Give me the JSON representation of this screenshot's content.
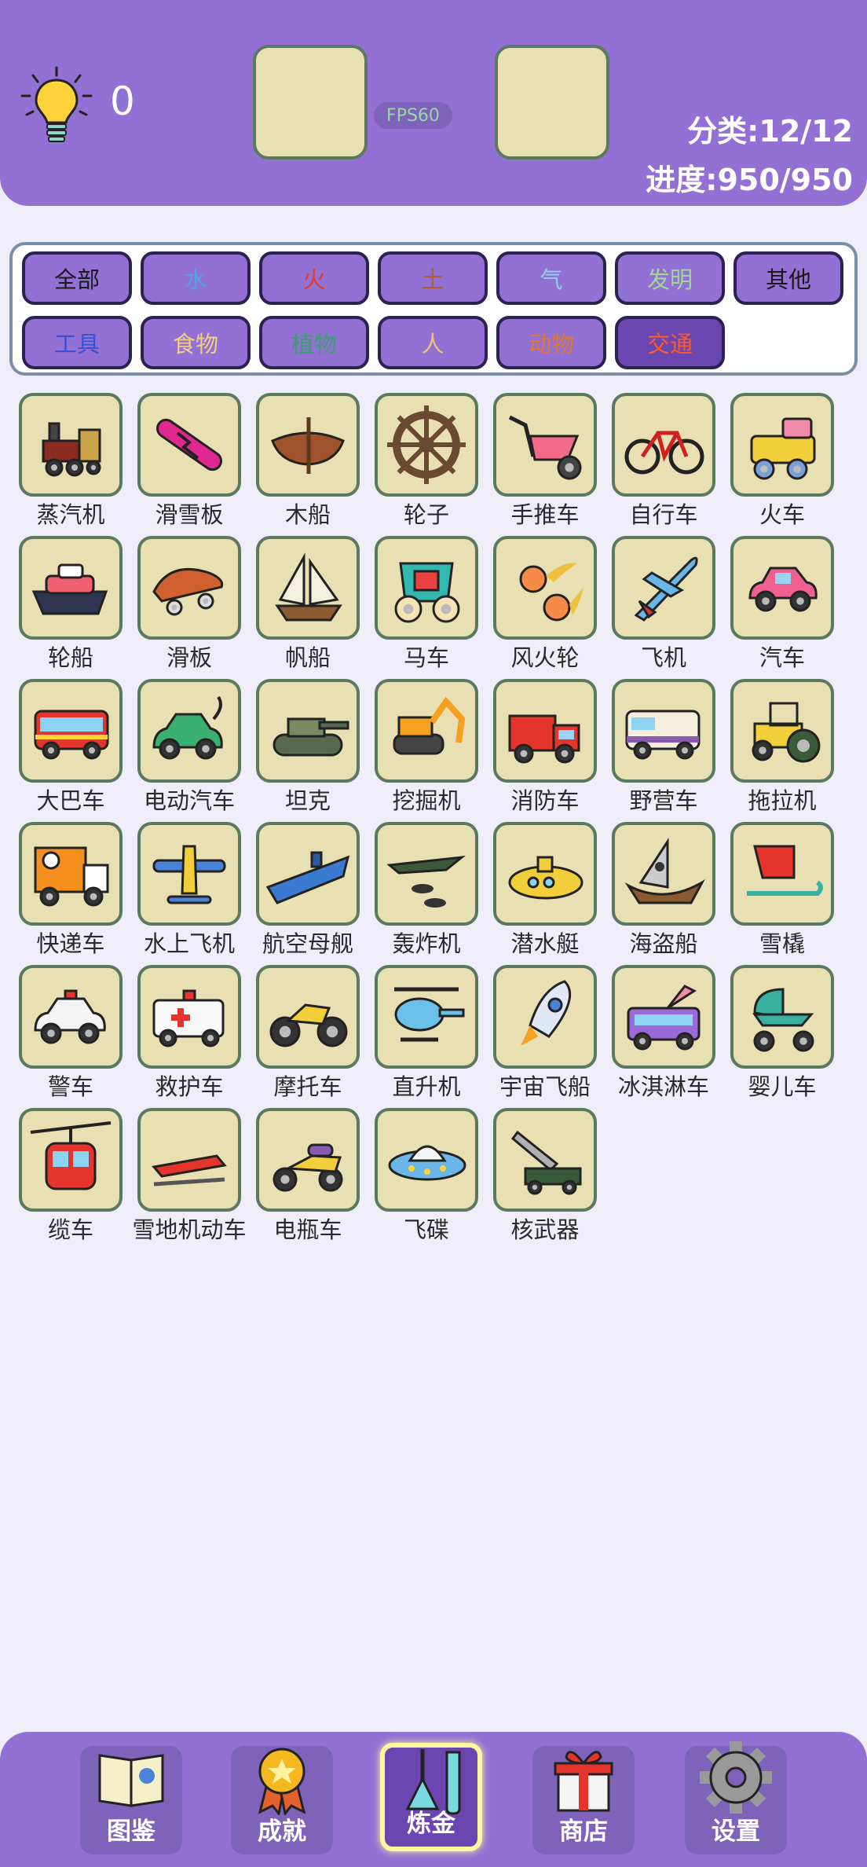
{
  "header": {
    "hint_count": "0",
    "fps_label": "FPS60",
    "category_count": "分类:12/12",
    "progress": "进度:950/950"
  },
  "filters": [
    {
      "label": "全部",
      "color": "#1a1a1a"
    },
    {
      "label": "水",
      "color": "#4aa6e0"
    },
    {
      "label": "火",
      "color": "#e0402c"
    },
    {
      "label": "土",
      "color": "#b06030"
    },
    {
      "label": "气",
      "color": "#8fd0e8"
    },
    {
      "label": "发明",
      "color": "#9fd89a"
    },
    {
      "label": "其他",
      "color": "#1a1a1a"
    },
    {
      "label": "工具",
      "color": "#3a50d0"
    },
    {
      "label": "食物",
      "color": "#f0d080"
    },
    {
      "label": "植物",
      "color": "#3aa070"
    },
    {
      "label": "人",
      "color": "#f0c070"
    },
    {
      "label": "动物",
      "color": "#e07830"
    },
    {
      "label": "交通",
      "color": "#ff5a2c",
      "active": true
    }
  ],
  "items": [
    {
      "label": "蒸汽机",
      "icon": "steam-engine-icon"
    },
    {
      "label": "滑雪板",
      "icon": "snowboard-icon"
    },
    {
      "label": "木船",
      "icon": "wooden-boat-icon"
    },
    {
      "label": "轮子",
      "icon": "wheel-icon"
    },
    {
      "label": "手推车",
      "icon": "wheelbarrow-icon"
    },
    {
      "label": "自行车",
      "icon": "bicycle-icon"
    },
    {
      "label": "火车",
      "icon": "train-icon"
    },
    {
      "label": "轮船",
      "icon": "steamship-icon"
    },
    {
      "label": "滑板",
      "icon": "skateboard-icon"
    },
    {
      "label": "帆船",
      "icon": "sailboat-icon"
    },
    {
      "label": "马车",
      "icon": "carriage-icon"
    },
    {
      "label": "风火轮",
      "icon": "fire-wheels-icon"
    },
    {
      "label": "飞机",
      "icon": "airplane-icon"
    },
    {
      "label": "汽车",
      "icon": "car-icon"
    },
    {
      "label": "大巴车",
      "icon": "bus-icon"
    },
    {
      "label": "电动汽车",
      "icon": "electric-car-icon"
    },
    {
      "label": "坦克",
      "icon": "tank-icon"
    },
    {
      "label": "挖掘机",
      "icon": "excavator-icon"
    },
    {
      "label": "消防车",
      "icon": "fire-truck-icon"
    },
    {
      "label": "野营车",
      "icon": "camper-icon"
    },
    {
      "label": "拖拉机",
      "icon": "tractor-icon"
    },
    {
      "label": "快递车",
      "icon": "delivery-truck-icon"
    },
    {
      "label": "水上飞机",
      "icon": "seaplane-icon"
    },
    {
      "label": "航空母舰",
      "icon": "aircraft-carrier-icon"
    },
    {
      "label": "轰炸机",
      "icon": "bomber-icon"
    },
    {
      "label": "潜水艇",
      "icon": "submarine-icon"
    },
    {
      "label": "海盗船",
      "icon": "pirate-ship-icon"
    },
    {
      "label": "雪橇",
      "icon": "sled-icon"
    },
    {
      "label": "警车",
      "icon": "police-car-icon"
    },
    {
      "label": "救护车",
      "icon": "ambulance-icon"
    },
    {
      "label": "摩托车",
      "icon": "motorcycle-icon"
    },
    {
      "label": "直升机",
      "icon": "helicopter-icon"
    },
    {
      "label": "宇宙飞船",
      "icon": "rocket-icon"
    },
    {
      "label": "冰淇淋车",
      "icon": "ice-cream-truck-icon"
    },
    {
      "label": "婴儿车",
      "icon": "stroller-icon"
    },
    {
      "label": "缆车",
      "icon": "cable-car-icon"
    },
    {
      "label": "雪地机动车",
      "icon": "snowmobile-icon"
    },
    {
      "label": "电瓶车",
      "icon": "scooter-icon"
    },
    {
      "label": "飞碟",
      "icon": "ufo-icon"
    },
    {
      "label": "核武器",
      "icon": "nuclear-missile-icon"
    }
  ],
  "nav": [
    {
      "label": "图鉴",
      "icon": "book-icon"
    },
    {
      "label": "成就",
      "icon": "medal-icon"
    },
    {
      "label": "炼金",
      "icon": "flask-icon",
      "active": true
    },
    {
      "label": "商店",
      "icon": "gift-icon"
    },
    {
      "label": "设置",
      "icon": "gear-icon"
    }
  ],
  "colors": {
    "header_bg": "#9370d3",
    "tile_bg": "#e8dfb2",
    "tile_border": "#5a7a60",
    "page_bg": "#efedf8"
  }
}
